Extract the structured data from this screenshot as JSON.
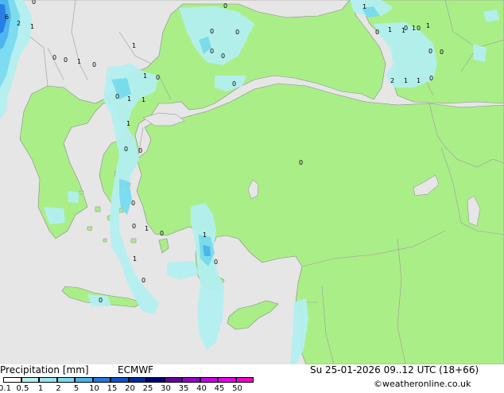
{
  "title": "Precipitation [mm]",
  "model": "ECMWF",
  "datetime": "Su 25-01-2026 09..12 UTC (18+66)",
  "credit": "©weatheronline.co.uk",
  "colors": {
    "sea": "#e6e6e6",
    "land": "#aaee88",
    "precip_light": "#b4f0f0",
    "precip_mid": "#78dcf0",
    "precip_heavy": "#46b4f0",
    "precip_max": "#1e78e6"
  },
  "legend": {
    "ticks": [
      "0.1",
      "0.5",
      "1",
      "2",
      "5",
      "10",
      "15",
      "20",
      "25",
      "30",
      "35",
      "40",
      "45",
      "50"
    ],
    "colors": [
      "#fefefe",
      "#b4f0f0",
      "#96e6f0",
      "#78dcf0",
      "#46b4f0",
      "#1e78e6",
      "#1450c8",
      "#0028a0",
      "#000080",
      "#6400a0",
      "#9600c8",
      "#c800e6",
      "#e600e6",
      "#f000c8"
    ]
  },
  "map_labels": [
    "6",
    "2",
    "0",
    "1",
    "0",
    "0",
    "1",
    "0",
    "1",
    "1",
    "0",
    "0",
    "1",
    "1",
    "1",
    "0",
    "0",
    "0",
    "0",
    "1",
    "0",
    "1",
    "0",
    "0",
    "0",
    "2",
    "1",
    "1",
    "0",
    "0",
    "0",
    "0",
    "0",
    "0",
    "1",
    "0",
    "1",
    "1",
    "1",
    "1",
    "0",
    "0",
    "0",
    "0",
    "0",
    "0",
    "1"
  ]
}
